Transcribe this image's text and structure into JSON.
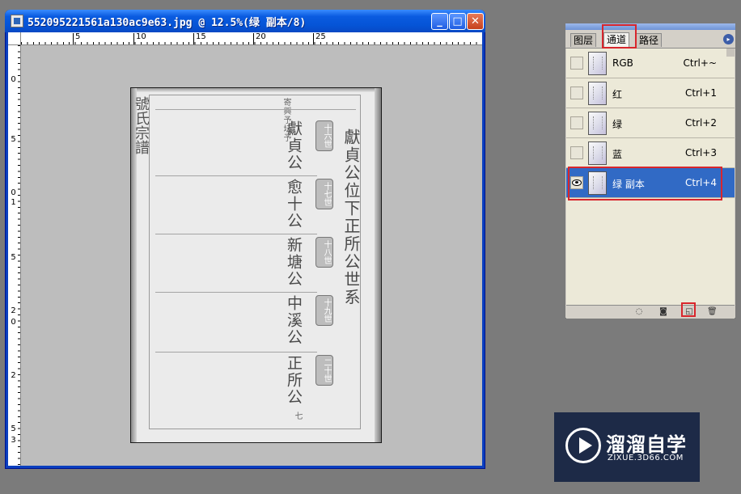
{
  "document_window": {
    "title": "552095221561a130ac9e63.jpg @ 12.5%(绿 副本/8)",
    "buttons": {
      "minimize": "_",
      "maximize": "□",
      "close": "✕"
    },
    "ruler_h_labels": [
      "5",
      "10",
      "15",
      "20",
      "25"
    ],
    "ruler_v_labels": [
      "0",
      "5",
      "0",
      "1",
      "5",
      "2",
      "0",
      "2",
      "5",
      "3"
    ]
  },
  "scan_page": {
    "left_title": "號氏宗譜",
    "center_heading": "獻貞公位下正所公世系",
    "name_columns": [
      "獻貞公",
      "愈十公",
      "新塘公",
      "中溪公",
      "正所公"
    ],
    "generation_badges": [
      "十六世",
      "十七世",
      "十八世",
      "十九世",
      "二十世"
    ],
    "page_number": "七",
    "top_right_note": "寄興予坛予"
  },
  "channels_panel": {
    "tabs": [
      "图层",
      "通道",
      "路径"
    ],
    "active_tab": "通道",
    "menu_icon": "▸",
    "channels": [
      {
        "name": "RGB",
        "shortcut": "Ctrl+~",
        "visible": false,
        "selected": false
      },
      {
        "name": "红",
        "shortcut": "Ctrl+1",
        "visible": false,
        "selected": false
      },
      {
        "name": "绿",
        "shortcut": "Ctrl+2",
        "visible": false,
        "selected": false
      },
      {
        "name": "蓝",
        "shortcut": "Ctrl+3",
        "visible": false,
        "selected": false
      },
      {
        "name": "绿 副本",
        "shortcut": "Ctrl+4",
        "visible": true,
        "selected": true
      }
    ],
    "bottom_icons": [
      "load-selection-icon",
      "save-selection-icon",
      "new-channel-icon",
      "delete-channel-icon"
    ],
    "bottom_glyphs": [
      "◌",
      "◙",
      "◱",
      "🗑"
    ]
  },
  "watermark": {
    "brand_cn": "溜溜自学",
    "brand_url": "ZIXUE.3D66.COM"
  },
  "colors": {
    "title_bar": "#0554d6",
    "selected_row": "#316ac5",
    "highlight_red": "#d8262c",
    "panel_bg": "#d4d0c8"
  }
}
